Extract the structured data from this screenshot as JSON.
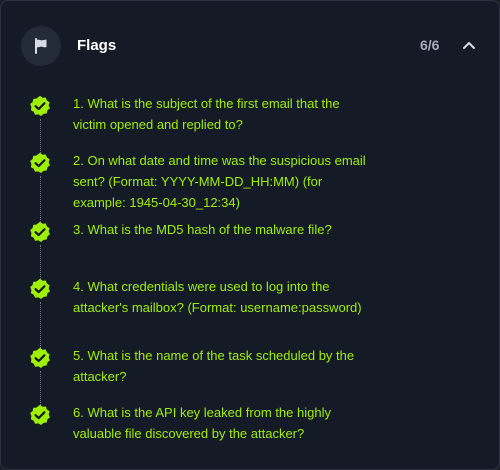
{
  "header": {
    "title": "Flags",
    "progress": "6/6",
    "flag_icon": "flag-icon",
    "collapse_icon": "chevron-up-icon"
  },
  "colors": {
    "accent": "#9fef00",
    "background": "#151b26",
    "icon_circle": "#232b39",
    "title": "#ffffff",
    "count": "#a3acbb"
  },
  "flags": [
    {
      "number": 1,
      "text": "1. What is the subject of the first email that the victim opened and replied to?",
      "status": "completed"
    },
    {
      "number": 2,
      "text": "2. On what date and time was the suspicious email sent? (Format: YYYY-MM-DD_HH:MM) (for example: 1945-04-30_12:34)",
      "status": "completed"
    },
    {
      "number": 3,
      "text": "3. What is the MD5 hash of the malware file?",
      "status": "completed"
    },
    {
      "number": 4,
      "text": "4. What credentials were used to log into the attacker's mailbox? (Format: username:password)",
      "status": "completed"
    },
    {
      "number": 5,
      "text": "5. What is the name of the task scheduled by the attacker?",
      "status": "completed"
    },
    {
      "number": 6,
      "text": "6. What is the API key leaked from the highly valuable file discovered by the attacker?",
      "status": "completed"
    }
  ]
}
